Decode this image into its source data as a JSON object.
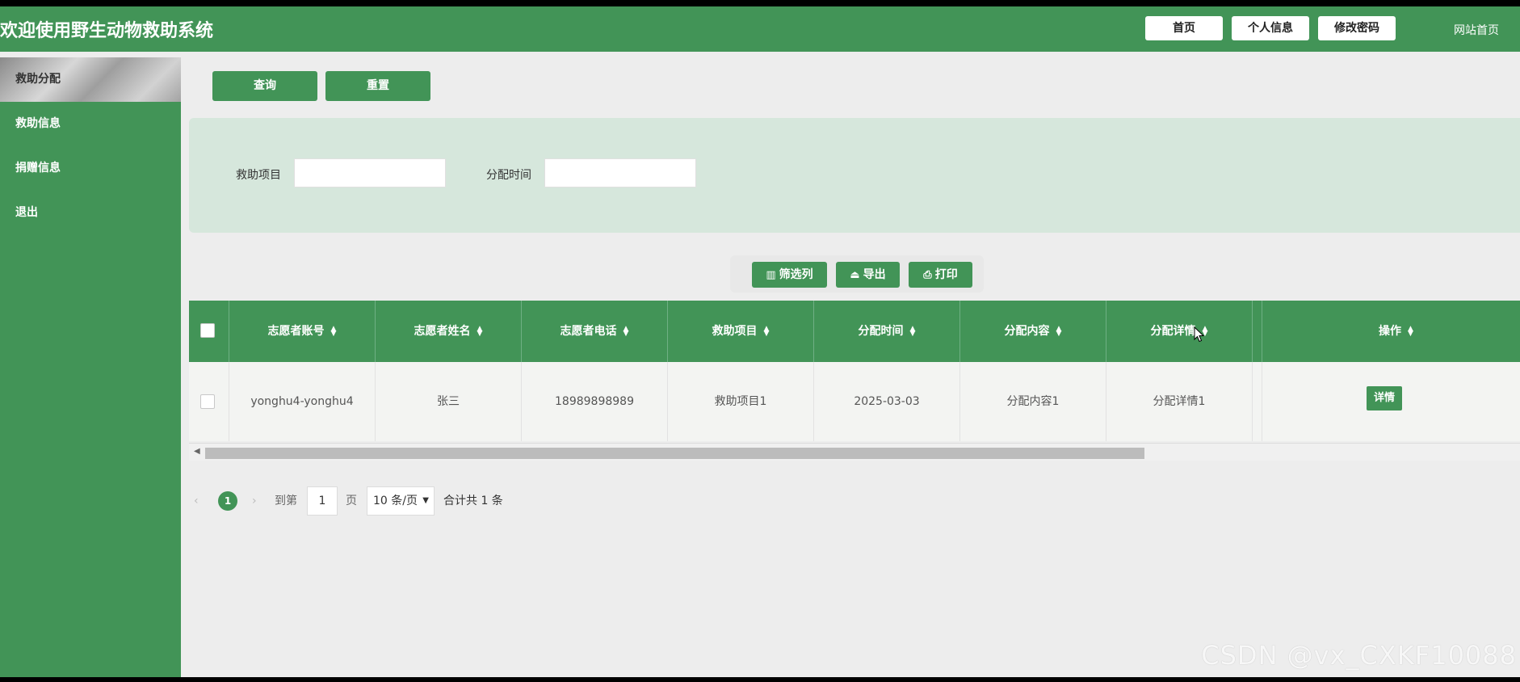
{
  "header": {
    "title": "欢迎使用野生动物救助系统",
    "nav": [
      "首页",
      "个人信息",
      "修改密码"
    ],
    "site_home": "网站首页"
  },
  "sidebar": {
    "items": [
      "救助分配",
      "救助信息",
      "捐赠信息",
      "退出"
    ],
    "active_index": 0
  },
  "actions": {
    "query": "查询",
    "reset": "重置"
  },
  "search": {
    "project_label": "救助项目",
    "project_value": "",
    "time_label": "分配时间",
    "time_value": ""
  },
  "tools": {
    "filter_columns": "筛选列",
    "export": "导出",
    "print": "打印"
  },
  "table": {
    "columns": [
      "志愿者账号",
      "志愿者姓名",
      "志愿者电话",
      "救助项目",
      "分配时间",
      "分配内容",
      "分配详情",
      "操作"
    ],
    "rows": [
      {
        "account": "yonghu4-yonghu4",
        "name": "张三",
        "phone": "18989898989",
        "project": "救助项目1",
        "time": "2025-03-03",
        "content": "分配内容1",
        "detail": "分配详情1",
        "action": "详情"
      }
    ]
  },
  "pager": {
    "current_page": "1",
    "goto_label": "到第",
    "goto_value": "1",
    "page_label": "页",
    "page_size": "10 条/页",
    "total_text": "合计共 1 条"
  },
  "watermark": "CSDN @vx_CXKF10088",
  "colors": {
    "primary": "#429457",
    "background": "#ededed",
    "search_panel": "#d6e7dc"
  }
}
